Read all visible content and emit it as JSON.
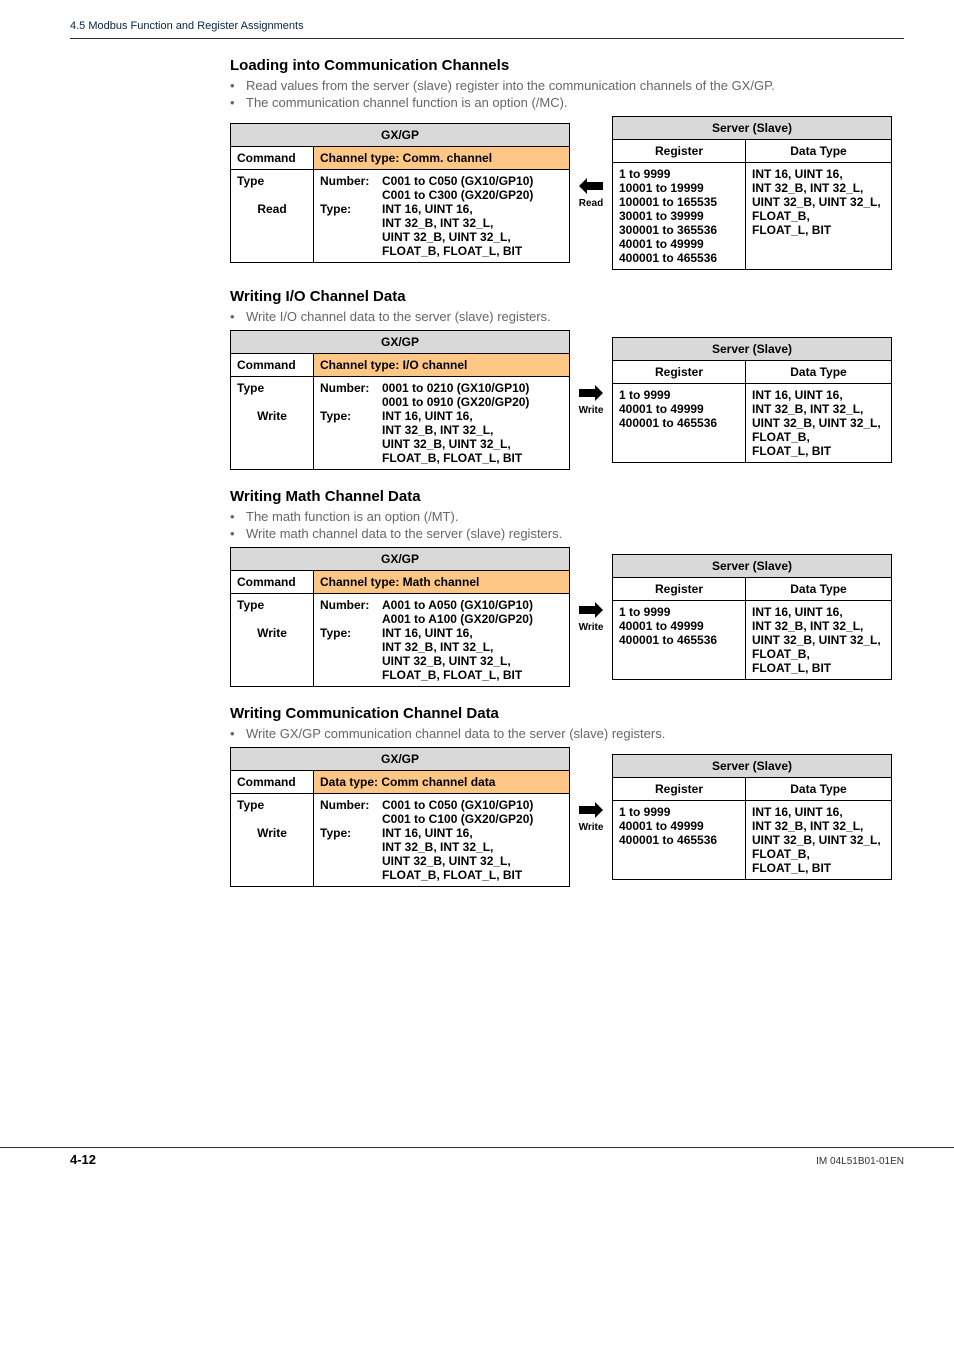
{
  "breadcrumb": "4.5  Modbus Function and Register Assignments",
  "sections": {
    "loading_comm": {
      "title": "Loading into Communication Channels",
      "bullets": [
        "Read values from the server (slave) register into the communication channels of the GX/GP.",
        "The communication channel function is an option (/MC)."
      ],
      "arrow_label": "Read",
      "left": {
        "header": "GX/GP",
        "command": "Command",
        "channel_type_label": "Channel type: Comm. channel",
        "type_label": "Type",
        "read_label": "Read",
        "number_label": "Number:",
        "number_vals": "C001 to C050 (GX10/GP10)\nC001 to C300 (GX20/GP20)",
        "type_prop_label": "Type:",
        "type_vals": "INT 16, UINT 16,\nINT 32_B, INT 32_L,\nUINT 32_B, UINT 32_L,\nFLOAT_B, FLOAT_L, BIT"
      },
      "right": {
        "header": "Server (Slave)",
        "reg_label": "Register",
        "dt_label": "Data Type",
        "reg_vals": "1 to 9999\n10001 to 19999\n100001 to 165535\n30001 to 39999\n300001 to 365536\n40001 to 49999\n400001 to 465536",
        "dt_vals": "INT 16, UINT 16,\nINT 32_B, INT 32_L,\nUINT 32_B, UINT 32_L,\nFLOAT_B,\nFLOAT_L, BIT"
      }
    },
    "writing_io": {
      "title": "Writing I/O Channel Data",
      "bullets": [
        "Write I/O channel data to the server (slave)  registers."
      ],
      "arrow_label": "Write",
      "left": {
        "header": "GX/GP",
        "command": "Command",
        "channel_type_label": "Channel type: I/O channel",
        "type_label": "Type",
        "write_label": "Write",
        "number_label": "Number:",
        "number_vals": "0001 to 0210 (GX10/GP10)\n0001 to 0910 (GX20/GP20)",
        "type_prop_label": "Type:",
        "type_vals": "INT 16, UINT 16,\nINT 32_B, INT 32_L,\nUINT 32_B, UINT 32_L,\nFLOAT_B, FLOAT_L, BIT"
      },
      "right": {
        "header": "Server (Slave)",
        "reg_label": "Register",
        "dt_label": "Data Type",
        "reg_vals": "1 to 9999\n40001 to 49999\n400001 to 465536",
        "dt_vals": "INT 16, UINT 16,\nINT 32_B, INT 32_L,\nUINT 32_B, UINT 32_L,\nFLOAT_B,\nFLOAT_L, BIT"
      }
    },
    "writing_math": {
      "title": "Writing Math Channel Data",
      "bullets": [
        "The math function is an option (/MT).",
        "Write math channel data to the server (slave) registers."
      ],
      "arrow_label": "Write",
      "left": {
        "header": "GX/GP",
        "command": "Command",
        "channel_type_label": "Channel type: Math channel",
        "type_label": "Type",
        "write_label": "Write",
        "number_label": "Number:",
        "number_vals": "A001 to A050 (GX10/GP10)\nA001 to A100 (GX20/GP20)",
        "type_prop_label": "Type:",
        "type_vals": "INT 16, UINT 16,\nINT 32_B, INT 32_L,\nUINT 32_B, UINT 32_L,\nFLOAT_B, FLOAT_L, BIT"
      },
      "right": {
        "header": "Server (Slave)",
        "reg_label": "Register",
        "dt_label": "Data Type",
        "reg_vals": "1 to 9999\n40001 to 49999\n400001 to 465536",
        "dt_vals": "INT 16, UINT 16,\nINT 32_B, INT 32_L,\nUINT 32_B, UINT 32_L,\nFLOAT_B,\nFLOAT_L, BIT"
      }
    },
    "writing_comm": {
      "title": "Writing Communication Channel Data",
      "bullets": [
        "Write GX/GP communication channel data to the server (slave) registers."
      ],
      "arrow_label": "Write",
      "left": {
        "header": "GX/GP",
        "command": "Command",
        "channel_type_label": "Data type: Comm channel data",
        "type_label": "Type",
        "write_label": "Write",
        "number_label": "Number:",
        "number_vals": "C001 to C050 (GX10/GP10)\nC001 to C100 (GX20/GP20)",
        "type_prop_label": "Type:",
        "type_vals": "INT 16, UINT 16,\nINT 32_B, INT 32_L,\nUINT 32_B, UINT 32_L,\nFLOAT_B, FLOAT_L, BIT"
      },
      "right": {
        "header": "Server (Slave)",
        "reg_label": "Register",
        "dt_label": "Data Type",
        "reg_vals": "1 to 9999\n40001 to 49999\n400001 to 465536",
        "dt_vals": "INT 16, UINT 16,\nINT 32_B, INT 32_L,\nUINT 32_B, UINT 32_L,\nFLOAT_B,\nFLOAT_L, BIT"
      }
    }
  },
  "footer": {
    "page": "4-12",
    "doc": "IM 04L51B01-01EN"
  }
}
